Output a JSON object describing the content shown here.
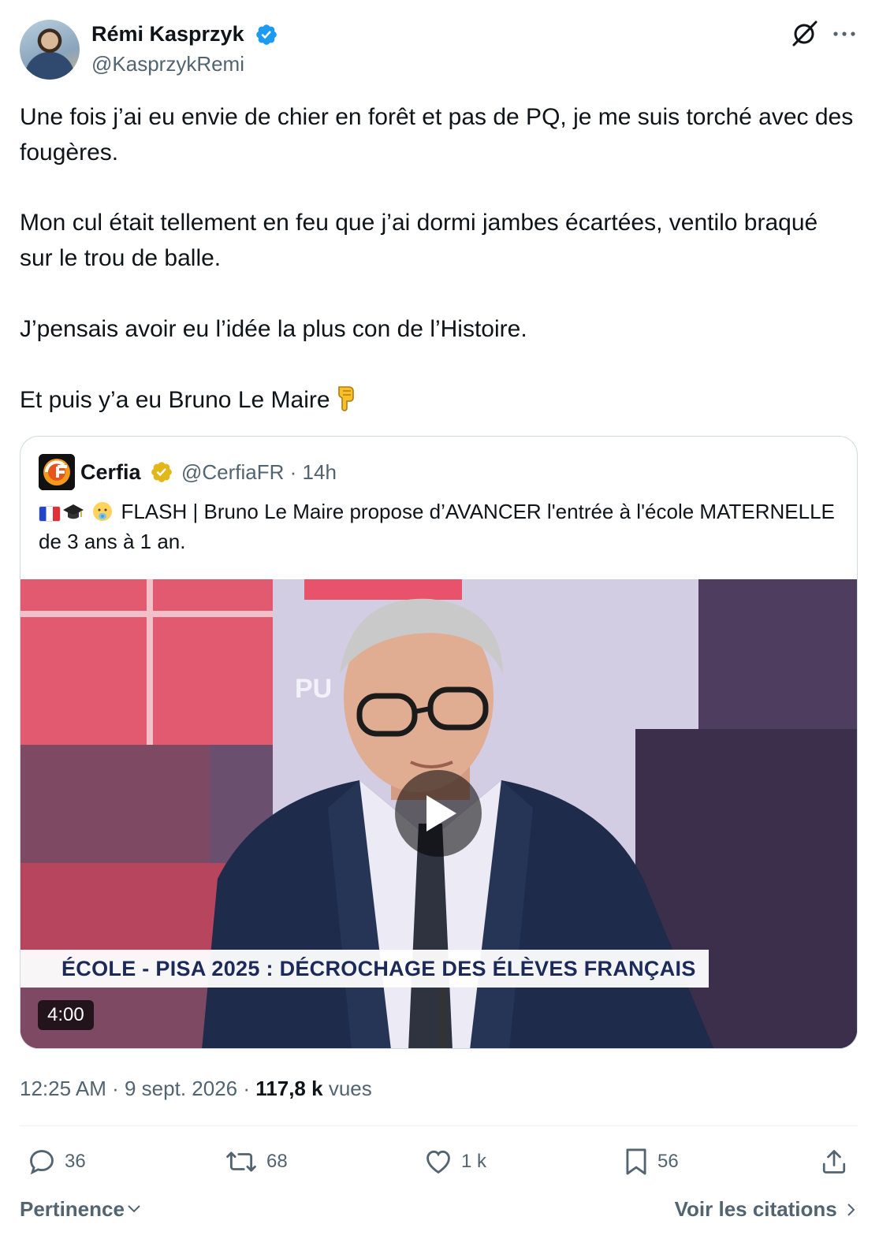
{
  "author": {
    "name": "Rémi Kasprzyk",
    "handle": "@KasprzykRemi"
  },
  "tweet": {
    "paragraphs": [
      "Une fois j’ai eu envie de chier en forêt et pas de PQ, je me suis torché avec des fougères.",
      "Mon cul était tellement en feu que j’ai dormi jambes écartées, ventilo braqué sur le trou de balle.",
      "J’pensais avoir eu l’idée la plus con de l’Histoire.",
      "Et puis y’a eu Bruno Le Maire"
    ],
    "emoji_icon": "backhand-index-pointing-down-icon"
  },
  "quoted": {
    "name": "Cerfia",
    "handle": "@CerfiaFR",
    "time": "· 14h",
    "text": "FLASH | Bruno Le Maire propose d’AVANCER l'entrée à l'école MATERNELLE de 3 ans à 1 an.",
    "emoji_icons": [
      "france-flag-icon",
      "graduation-cap-icon",
      "baby-icon"
    ],
    "video": {
      "banner": "ÉCOLE - PISA 2025 : DÉCROCHAGE DES ÉLÈVES FRANÇAIS",
      "duration": "4:00"
    }
  },
  "meta": {
    "time": "12:25 AM",
    "date": "9 sept. 2026",
    "views_count": "117,8 k",
    "views_label": "vues"
  },
  "actions": {
    "replies": "36",
    "retweets": "68",
    "likes": "1 k",
    "bookmarks": "56"
  },
  "footer": {
    "sort_label": "Pertinence",
    "quotes_label": "Voir les citations"
  },
  "colors": {
    "text": "#0f1419",
    "secondary": "#536471",
    "verified_blue": "#1d9bf0",
    "verified_gold": "#e2b719"
  }
}
